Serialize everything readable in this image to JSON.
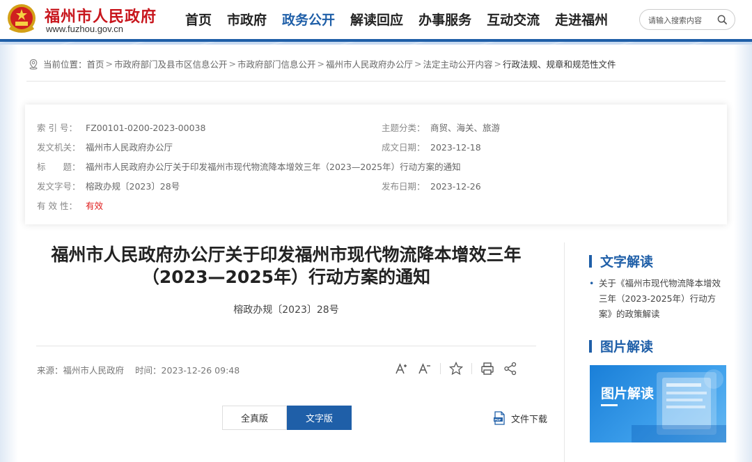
{
  "header": {
    "site_name": "福州市人民政府",
    "site_url": "www.fuzhou.gov.cn",
    "nav": [
      {
        "label": "首页",
        "active": false
      },
      {
        "label": "市政府",
        "active": false
      },
      {
        "label": "政务公开",
        "active": true
      },
      {
        "label": "解读回应",
        "active": false
      },
      {
        "label": "办事服务",
        "active": false
      },
      {
        "label": "互动交流",
        "active": false
      },
      {
        "label": "走进福州",
        "active": false
      }
    ],
    "search_placeholder": "请输入搜索内容"
  },
  "breadcrumb": {
    "prefix": "当前位置：",
    "items": [
      "首页",
      "市政府部门及县市区信息公开",
      "市政府部门信息公开",
      "福州市人民政府办公厅",
      "法定主动公开内容",
      "行政法规、规章和规范性文件"
    ],
    "separator": ">"
  },
  "meta": {
    "index_label": "索 引 号：",
    "index_value": "FZ00101-0200-2023-00038",
    "topic_label": "主题分类：",
    "topic_value": "商贸、海关、旅游",
    "issuer_label": "发文机关：",
    "issuer_value": "福州市人民政府办公厅",
    "written_label": "成文日期：",
    "written_value": "2023-12-18",
    "title_label": "标　　题：",
    "title_value": "福州市人民政府办公厅关于印发福州市现代物流降本增效三年（2023—2025年）行动方案的通知",
    "docnum_label": "发文字号：",
    "docnum_value": "榕政办规〔2023〕28号",
    "published_label": "发布日期：",
    "published_value": "2023-12-26",
    "validity_label": "有 效 性：",
    "validity_value": "有效"
  },
  "article": {
    "title_line1": "福州市人民政府办公厅关于印发福州市现代物流降本增效三年",
    "title_line2": "（2023—2025年）行动方案的通知",
    "docnum": "榕政办规〔2023〕28号",
    "source_label": "来源：",
    "source_value": "福州市人民政府",
    "time_label": "时间：",
    "time_value": "2023-12-26 09:48",
    "btn_full": "全真版",
    "btn_text": "文字版",
    "download_label": "文件下载"
  },
  "sidebar": {
    "text_heading": "文字解读",
    "text_item": "关于《福州市现代物流降本增效三年（2023-2025年）行动方案》的政策解读",
    "pic_heading": "图片解读",
    "pic_card_title": "图片解读"
  },
  "colors": {
    "brand_red": "#c8161d",
    "brand_blue": "#1f5fa8"
  }
}
